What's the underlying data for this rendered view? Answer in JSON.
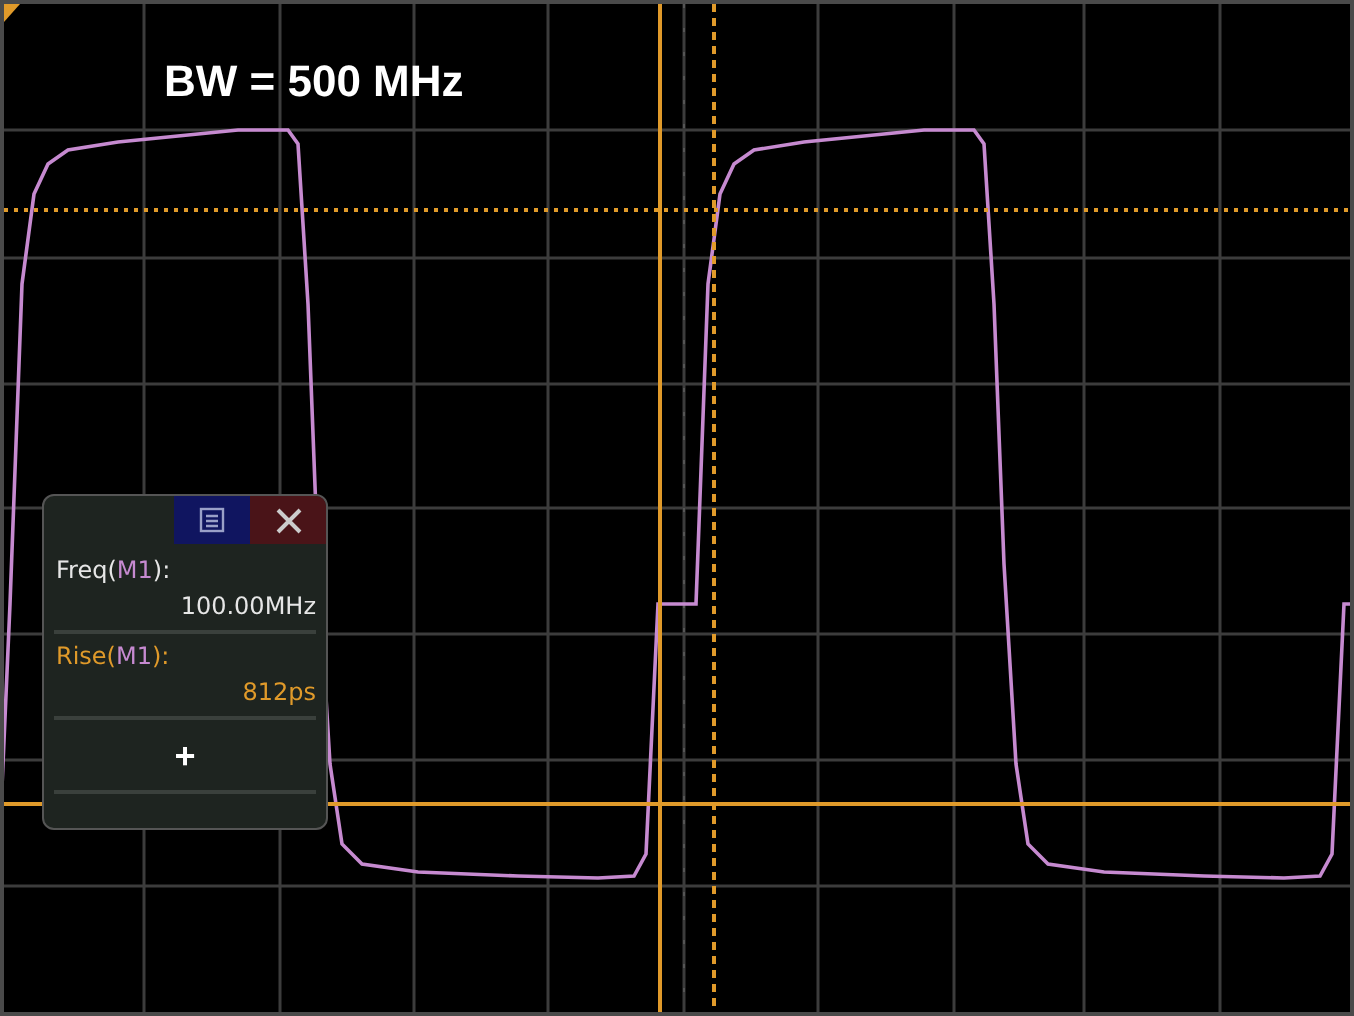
{
  "annotation": "BW = 500 MHz",
  "measure_panel": {
    "measurements": [
      {
        "label_parts": [
          "Freq(",
          "M1",
          "):"
        ],
        "value": "100.00MHz",
        "kind": "plain"
      },
      {
        "label_parts": [
          "Rise(",
          "M1",
          "):"
        ],
        "value": "812ps",
        "kind": "highlighted"
      }
    ],
    "add_label": "+"
  }
}
